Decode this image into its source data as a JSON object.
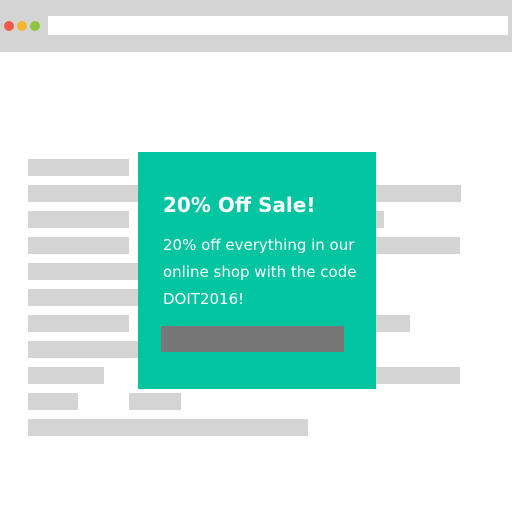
{
  "browser": {
    "controls": [
      "close",
      "minimize",
      "maximize"
    ]
  },
  "popup": {
    "title": "20% Off Sale!",
    "body": "20% off everything in our online shop with the code DOIT2016!",
    "background_color": "#00c5a0",
    "button_color": "#777777"
  }
}
